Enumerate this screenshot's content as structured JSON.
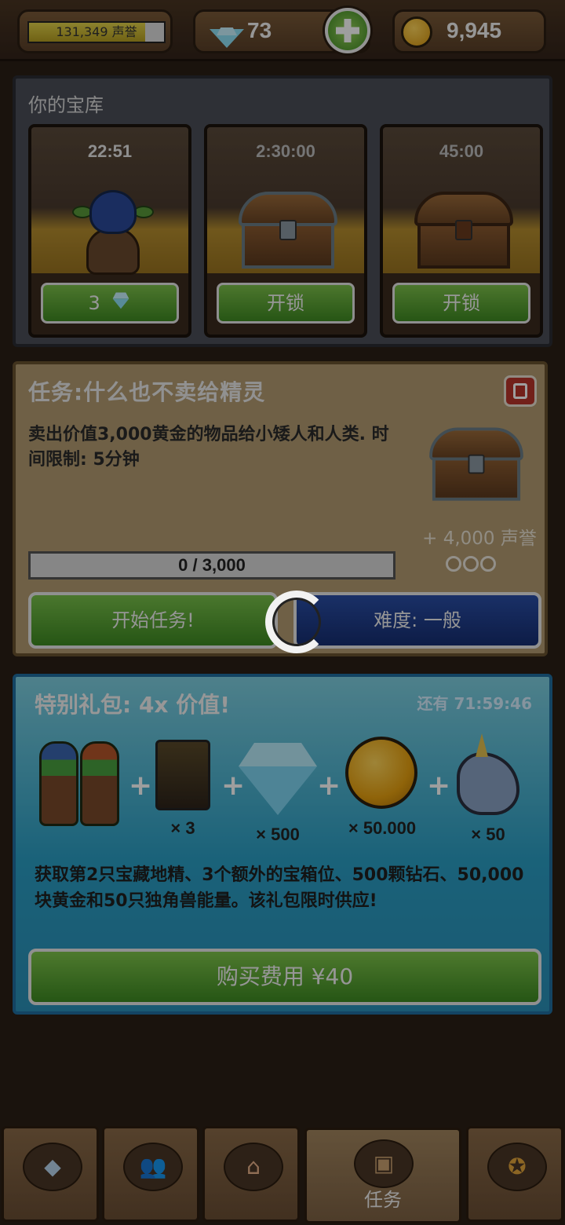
{
  "topbar": {
    "reputation_text": "131,349 声誉",
    "reputation_progress": 0.86,
    "gems": "73",
    "gold": "9,945",
    "gem_icon": "diamond-icon",
    "gold_icon": "gold-coin-icon",
    "add_icon": "plus-icon"
  },
  "vault": {
    "title": "你的宝库",
    "slots": [
      {
        "timer": "22:51",
        "button": "3",
        "button_icon": "diamond-icon",
        "content": "goblin-opening-chest"
      },
      {
        "timer": "2:30:00",
        "button": "开锁",
        "content": "iron-chest"
      },
      {
        "timer": "45:00",
        "button": "开锁",
        "content": "wooden-chest"
      }
    ]
  },
  "quest": {
    "title": "任务:什么也不卖给精灵",
    "description": "卖出价值3,000黄金的物品给小矮人和人类. 时间限制: 5分钟",
    "reward": "+ 4,000 声誉",
    "progress_text": "0 / 3,000",
    "progress_fraction": 0,
    "start_button": "开始任务!",
    "difficulty_button": "难度: 一般",
    "difficulty_dots": 3
  },
  "offer": {
    "title": "特别礼包: 4x 价值!",
    "timer": "还有 71:59:46",
    "items": [
      {
        "name": "goblins",
        "qty": ""
      },
      {
        "name": "chest-slot-card",
        "qty": "× 3"
      },
      {
        "name": "diamond",
        "qty": "× 500"
      },
      {
        "name": "gold-coin",
        "qty": "× 50.000"
      },
      {
        "name": "unicorn",
        "qty": "× 50"
      }
    ],
    "plus": "+",
    "description": "获取第2只宝藏地精、3个额外的宝箱位、500颗钻石、50,000块黄金和50只独角兽能量。该礼包限时供应!",
    "buy_button": "购买费用 ¥40"
  },
  "nav": {
    "tabs": [
      {
        "icon": "diamond-icon",
        "glyph": "◆",
        "label": ""
      },
      {
        "icon": "people-icon",
        "glyph": "👥",
        "label": ""
      },
      {
        "icon": "shop-icon",
        "glyph": "⌂",
        "label": ""
      },
      {
        "icon": "chest-icon",
        "glyph": "▣",
        "label": "任务"
      },
      {
        "icon": "medal-icon",
        "glyph": "✪",
        "label": ""
      }
    ],
    "active_index": 3
  },
  "colors": {
    "green_button": "#5aa632",
    "blue_button": "#1f3f8c",
    "offer_panel": "#2a9ec4",
    "quest_panel": "#b39c72"
  }
}
